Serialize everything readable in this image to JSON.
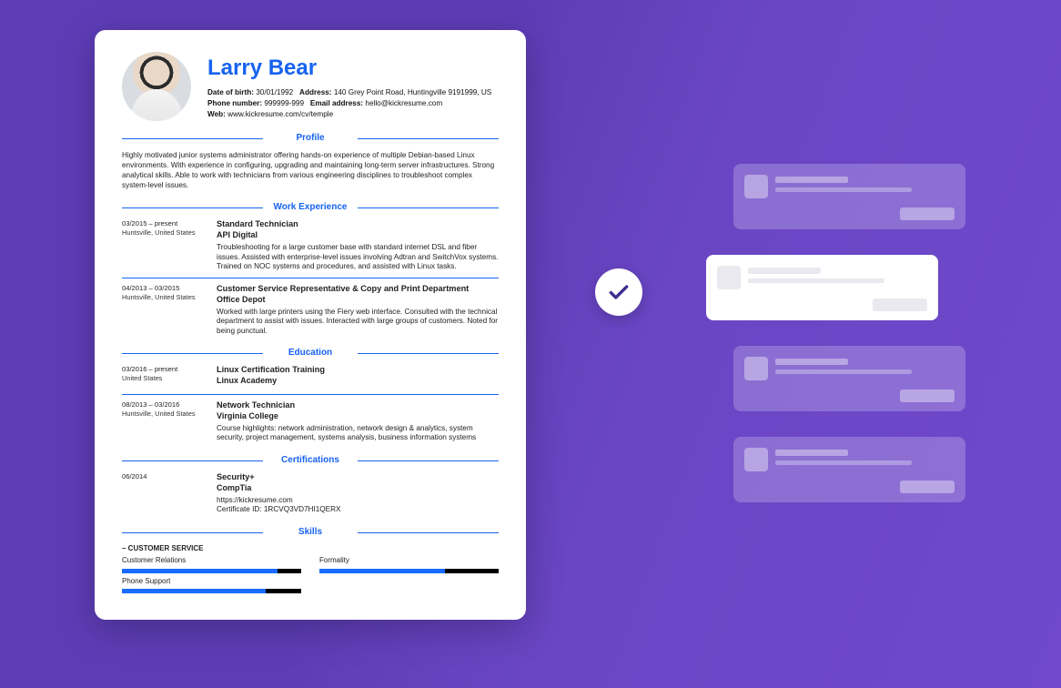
{
  "resume": {
    "name": "Larry Bear",
    "meta": {
      "dob_label": "Date of birth:",
      "dob": "30/01/1992",
      "addr_label": "Address:",
      "addr": "140 Grey Point Road, Huntingville 9191999, US",
      "phone_label": "Phone number:",
      "phone": "999999-999",
      "email_label": "Email address:",
      "email": "hello@kickresume.com",
      "web_label": "Web:",
      "web": "www.kickresume.com/cv/temple"
    },
    "sections": {
      "profile": "Profile",
      "work": "Work Experience",
      "education": "Education",
      "certs": "Certifications",
      "skills": "Skills"
    },
    "profile_text": "Highly motivated junior systems administrator offering hands-on experience of multiple Debian-based Linux environments. With experience in configuring, upgrading and maintaining long-term server infrastructures. Strong analytical skills. Able to work with technicians from various engineering disciplines to troubleshoot complex system-level issues.",
    "work": [
      {
        "dates": "03/2015 – present",
        "loc": "Huntsville, United States",
        "title": "Standard Technician",
        "company": "API Digital",
        "desc": "Troubleshooting for a large customer base with standard internet DSL and fiber issues. Assisted with enterprise-level issues involving Adtran and SwitchVox systems. Trained on NOC systems and procedures, and assisted with Linux tasks."
      },
      {
        "dates": "04/2013 – 03/2015",
        "loc": "Huntsville, United States",
        "title": "Customer Service Representative & Copy and Print Department",
        "company": "Office Depot",
        "desc": "Worked with large printers using the Fiery web interface. Consulted with the technical department to assist with issues. Interacted with large groups of customers. Noted for being punctual."
      }
    ],
    "education": [
      {
        "dates": "03/2016 – present",
        "loc": "United States",
        "title": "Linux Certification Training",
        "company": "Linux Academy",
        "desc": ""
      },
      {
        "dates": "08/2013 – 03/2016",
        "loc": "Huntsville, United States",
        "title": "Network Technician",
        "company": "Virginia College",
        "desc": "Course highlights: network administration, network design & analytics, system security, project management, systems analysis, business information systems"
      }
    ],
    "certs": [
      {
        "dates": "06/2014",
        "loc": "",
        "title": "Security+",
        "company": "CompTia",
        "desc": "https://kickresume.com",
        "extra": "Certificate ID: 1RCVQ3VD7HI1QERX"
      }
    ],
    "skills_cat": "– CUSTOMER SERVICE",
    "skills": [
      {
        "label": "Customer Relations",
        "value": 87
      },
      {
        "label": "Formality",
        "value": 70
      },
      {
        "label": "Phone Support",
        "value": 80
      }
    ]
  },
  "icons": {
    "check": "checkmark"
  }
}
